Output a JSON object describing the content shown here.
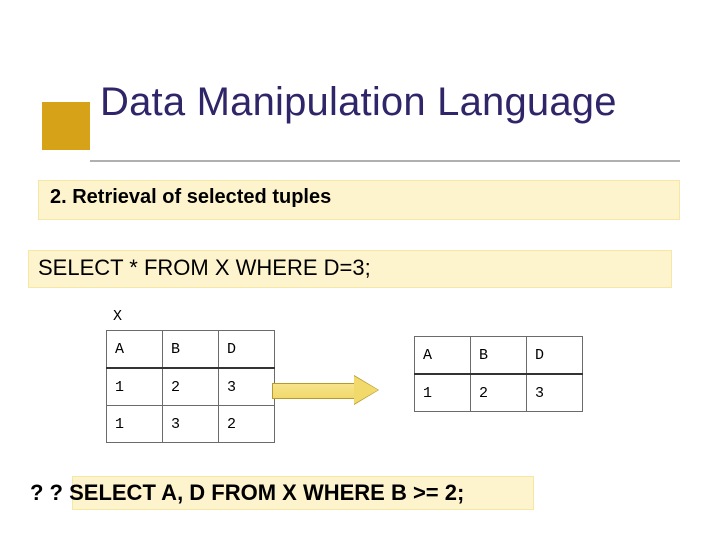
{
  "title": "Data Manipulation Language",
  "subtitle": "2. Retrieval of selected tuples",
  "sql": "SELECT * FROM X WHERE D=3;",
  "table_x": {
    "label": "X",
    "headers": [
      "A",
      "B",
      "D"
    ],
    "rows": [
      [
        "1",
        "2",
        "3"
      ],
      [
        "1",
        "3",
        "2"
      ]
    ]
  },
  "table_result": {
    "headers": [
      "A",
      "B",
      "D"
    ],
    "rows": [
      [
        "1",
        "2",
        "3"
      ]
    ]
  },
  "footer": "? ? SELECT A, D FROM X WHERE B >= 2;"
}
